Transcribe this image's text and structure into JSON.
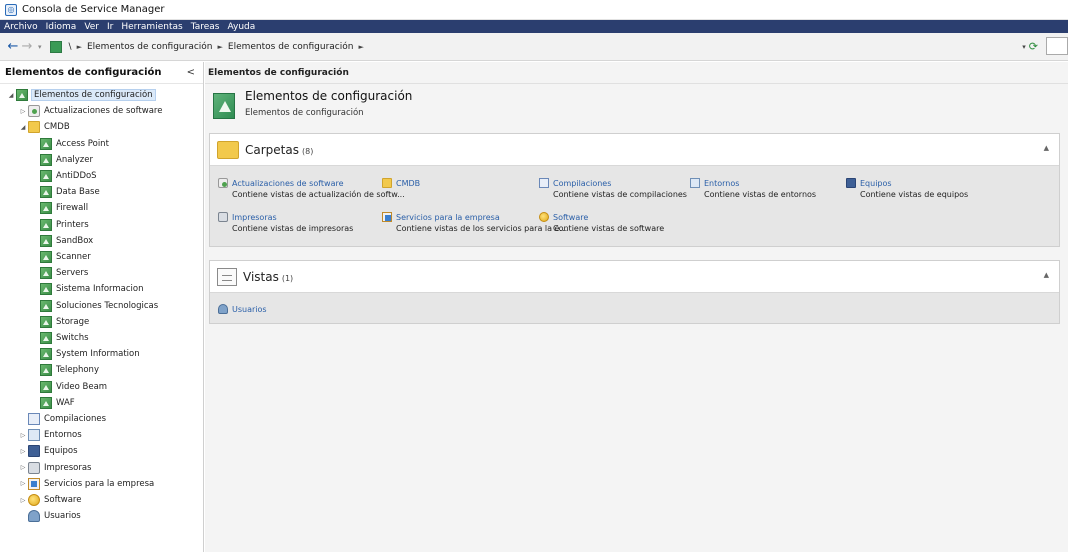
{
  "window": {
    "title": "Consola de Service Manager"
  },
  "menu": [
    "Archivo",
    "Idioma",
    "Ver",
    "Ir",
    "Herramientas",
    "Tareas",
    "Ayuda"
  ],
  "address": {
    "root": "\\",
    "crumbs": [
      "Elementos de configuración",
      "Elementos de configuración"
    ]
  },
  "leftnav": {
    "title": "Elementos de configuración",
    "collapse_glyph": "<",
    "tree": [
      {
        "label": "Elementos de configuración",
        "level": 0,
        "icon": "config-item-icon",
        "expander": "expanded",
        "selected": true
      },
      {
        "label": "Actualizaciones de software",
        "level": 1,
        "icon": "software-update-icon",
        "expander": "collapsed"
      },
      {
        "label": "CMDB",
        "level": 1,
        "icon": "folder-icon",
        "expander": "expanded"
      },
      {
        "label": "Access Point",
        "level": 2,
        "icon": "config-item-icon"
      },
      {
        "label": "Analyzer",
        "level": 2,
        "icon": "config-item-icon"
      },
      {
        "label": "AntiDDoS",
        "level": 2,
        "icon": "config-item-icon"
      },
      {
        "label": "Data Base",
        "level": 2,
        "icon": "config-item-icon"
      },
      {
        "label": "Firewall",
        "level": 2,
        "icon": "config-item-icon"
      },
      {
        "label": "Printers",
        "level": 2,
        "icon": "config-item-icon"
      },
      {
        "label": "SandBox",
        "level": 2,
        "icon": "config-item-icon"
      },
      {
        "label": "Scanner",
        "level": 2,
        "icon": "config-item-icon"
      },
      {
        "label": "Servers",
        "level": 2,
        "icon": "config-item-icon"
      },
      {
        "label": "Sistema Informacion",
        "level": 2,
        "icon": "config-item-icon"
      },
      {
        "label": "Soluciones Tecnologicas",
        "level": 2,
        "icon": "config-item-icon"
      },
      {
        "label": "Storage",
        "level": 2,
        "icon": "config-item-icon"
      },
      {
        "label": "Switchs",
        "level": 2,
        "icon": "config-item-icon"
      },
      {
        "label": "System Information",
        "level": 2,
        "icon": "config-item-icon"
      },
      {
        "label": "Telephony",
        "level": 2,
        "icon": "config-item-icon"
      },
      {
        "label": "Video Beam",
        "level": 2,
        "icon": "config-item-icon"
      },
      {
        "label": "WAF",
        "level": 2,
        "icon": "config-item-icon"
      },
      {
        "label": "Compilaciones",
        "level": 1,
        "icon": "build-icon"
      },
      {
        "label": "Entornos",
        "level": 1,
        "icon": "environment-icon",
        "expander": "collapsed"
      },
      {
        "label": "Equipos",
        "level": 1,
        "icon": "computer-icon",
        "expander": "collapsed"
      },
      {
        "label": "Impresoras",
        "level": 1,
        "icon": "printer-icon",
        "expander": "collapsed"
      },
      {
        "label": "Servicios para la empresa",
        "level": 1,
        "icon": "business-service-icon",
        "expander": "collapsed"
      },
      {
        "label": "Software",
        "level": 1,
        "icon": "software-icon",
        "expander": "collapsed"
      },
      {
        "label": "Usuarios",
        "level": 1,
        "icon": "users-icon"
      }
    ]
  },
  "main": {
    "header": "Elementos de configuración",
    "hero": {
      "title": "Elementos de configuración",
      "subtitle": "Elementos de configuración"
    },
    "folders": {
      "title": "Carpetas",
      "count": "(8)",
      "items": [
        {
          "title": "Actualizaciones de software",
          "desc": "Contiene vistas de actualización de softw...",
          "icon": "software-update-icon"
        },
        {
          "title": "CMDB",
          "desc": "",
          "icon": "folder-icon"
        },
        {
          "title": "Compilaciones",
          "desc": "Contiene vistas de compilaciones",
          "icon": "build-icon"
        },
        {
          "title": "Entornos",
          "desc": "Contiene vistas de entornos",
          "icon": "environment-icon"
        },
        {
          "title": "Equipos",
          "desc": "Contiene vistas de equipos",
          "icon": "computer-icon"
        },
        {
          "title": "Impresoras",
          "desc": "Contiene vistas de impresoras",
          "icon": "printer-icon"
        },
        {
          "title": "Servicios para la empresa",
          "desc": "Contiene vistas de los servicios para la e...",
          "icon": "business-service-icon"
        },
        {
          "title": "Software",
          "desc": "Contiene vistas de software",
          "icon": "software-icon"
        }
      ]
    },
    "views": {
      "title": "Vistas",
      "count": "(1)",
      "items": [
        {
          "title": "Usuarios",
          "icon": "users-icon"
        }
      ]
    }
  },
  "colors": {
    "menubar": "#2b3e6f",
    "link": "#2a5fa8",
    "selection": "#dbe9f8"
  }
}
